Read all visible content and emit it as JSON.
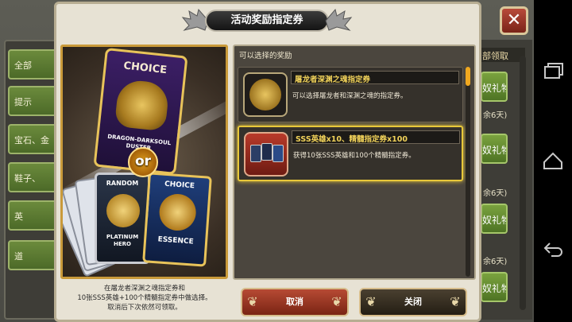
{
  "background": {
    "left_items": [
      "全部",
      "提示",
      "宝石、金",
      "鞋子、",
      "英",
      "道"
    ],
    "right_header": "部领取",
    "right_buttons": [
      "奴礼物",
      "奴礼物",
      "奴礼物",
      "奴礼物"
    ],
    "right_notes": [
      "余6天)",
      "余6天)",
      "余6天)"
    ],
    "close_label": "✕"
  },
  "dialog": {
    "title": "活动奖励指定券"
  },
  "promo": {
    "choice_card": {
      "title": "CHOICE",
      "subtitle": "DRAGON-DARKSOUL DUSTER"
    },
    "or_label": "or",
    "random_card": {
      "title": "RANDOM",
      "subtitle": "PLATINUM HERO"
    },
    "essence_card": {
      "title": "CHOICE",
      "subtitle": "ESSENCE"
    },
    "description_lines": [
      "在屠龙者深渊之魂指定券和",
      "10张SSS英雄+100个精髓指定券中做选择。",
      "取消后下次依然可领取。"
    ]
  },
  "rewards": {
    "header": "可以选择的奖励",
    "items": [
      {
        "title": "屠龙者深渊之魂指定券",
        "description": "可以选择屠龙者和深渊之魂的指定券。",
        "icon": "dragon-emblem-icon"
      },
      {
        "title": "SSS英雄x10、精髓指定券x100",
        "description": "获得10张SSS英雄和100个精髓指定券。",
        "icon": "hero-cards-icon"
      }
    ]
  },
  "buttons": {
    "cancel": "取消",
    "close": "关闭"
  },
  "colors": {
    "accent_gold": "#e8c83a",
    "cancel_red": "#b64a34",
    "dialog_bg": "#e7e2d4"
  }
}
